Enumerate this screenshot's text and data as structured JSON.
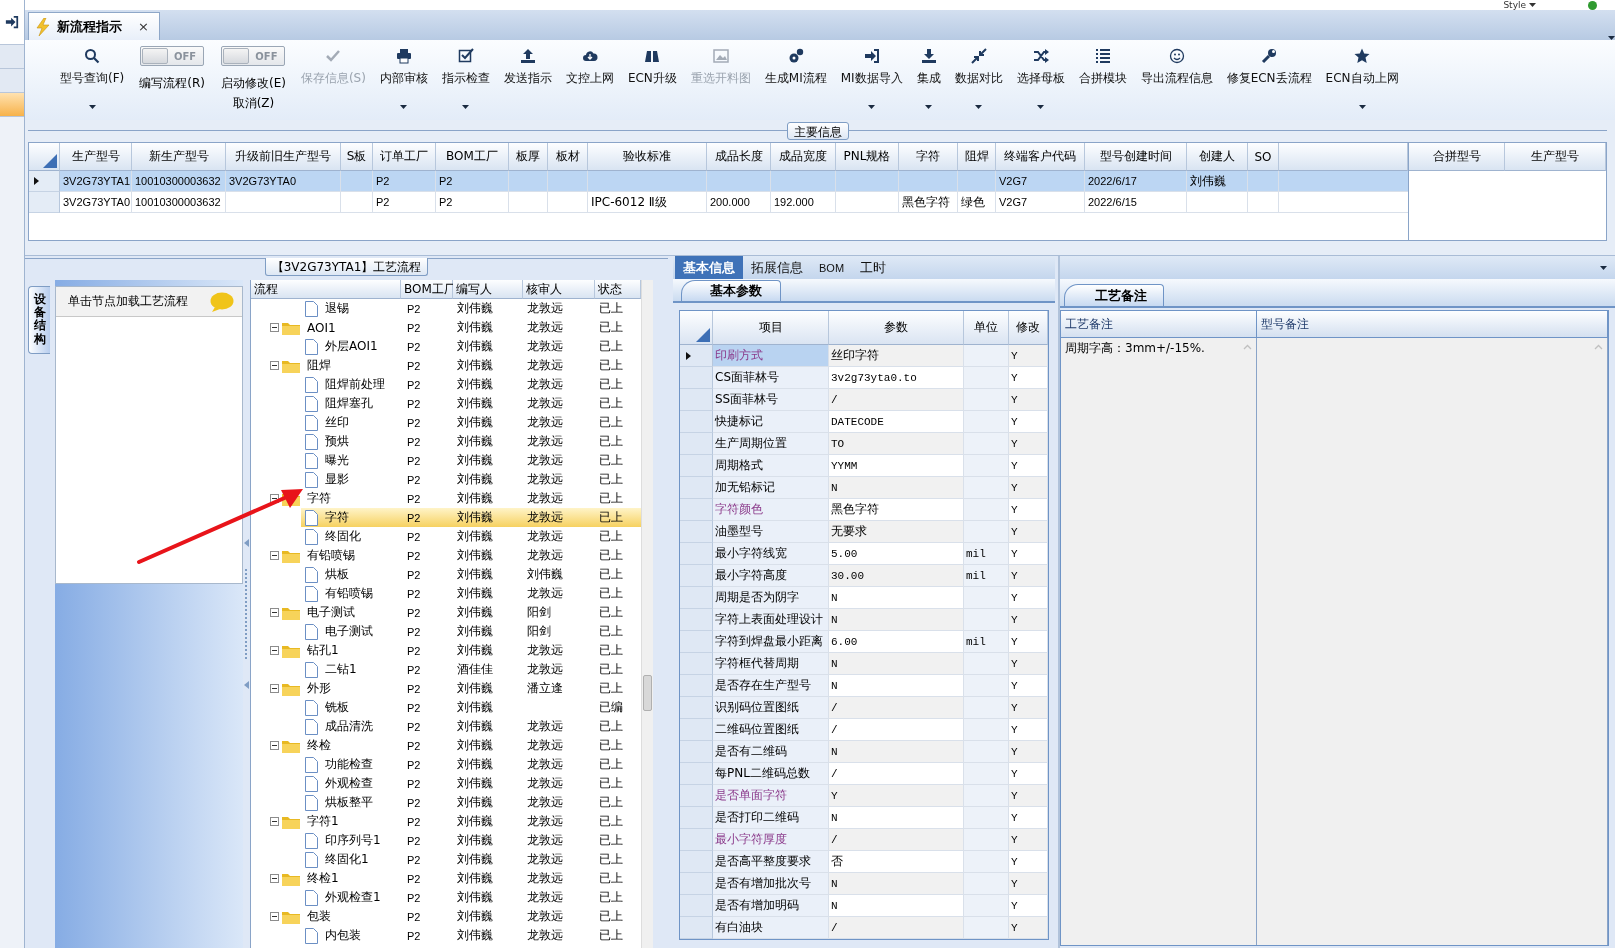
{
  "style_menu": {
    "label": "Style"
  },
  "left_nav": {
    "items": [
      {
        "selected": false
      },
      {
        "selected": false
      },
      {
        "selected": true
      }
    ]
  },
  "tabs": [
    {
      "label": "新流程指示",
      "selected": true,
      "close": "×"
    }
  ],
  "toolbar": {
    "items": [
      {
        "kind": "button",
        "label": "型号查询(F)",
        "dropdown": true,
        "disabled": false
      },
      {
        "kind": "toggle",
        "label": "编写流程(R)",
        "on": false,
        "switch_text": "OFF"
      },
      {
        "kind": "toggle",
        "label": "启动修改(E)",
        "sublabel": "取消(Z)",
        "on": false,
        "switch_text": "OFF"
      },
      {
        "kind": "button",
        "label": "保存信息(S)",
        "dropdown": false,
        "disabled": true
      },
      {
        "kind": "button",
        "label": "内部审核",
        "dropdown": true,
        "disabled": false
      },
      {
        "kind": "button",
        "label": "指示检查",
        "dropdown": true,
        "disabled": false
      },
      {
        "kind": "button",
        "label": "发送指示",
        "dropdown": false,
        "disabled": false
      },
      {
        "kind": "button",
        "label": "文控上网",
        "dropdown": false,
        "disabled": false
      },
      {
        "kind": "button",
        "label": "ECN升级",
        "dropdown": false,
        "disabled": false
      },
      {
        "kind": "button",
        "label": "重选开料图",
        "dropdown": false,
        "disabled": true
      },
      {
        "kind": "button",
        "label": "生成MI流程",
        "dropdown": false,
        "disabled": false
      },
      {
        "kind": "button",
        "label": "MI数据导入",
        "dropdown": true,
        "disabled": false
      },
      {
        "kind": "button",
        "label": "集成",
        "dropdown": true,
        "disabled": false
      },
      {
        "kind": "button",
        "label": "数据对比",
        "dropdown": true,
        "disabled": false
      },
      {
        "kind": "button",
        "label": "选择母板",
        "dropdown": true,
        "disabled": false
      },
      {
        "kind": "button",
        "label": "合拼模块",
        "dropdown": false,
        "disabled": false
      },
      {
        "kind": "button",
        "label": "导出流程信息",
        "dropdown": false,
        "disabled": false
      },
      {
        "kind": "button",
        "label": "修复ECN丢流程",
        "dropdown": false,
        "disabled": false
      },
      {
        "kind": "button",
        "label": "ECN自动上网",
        "dropdown": true,
        "disabled": false
      }
    ]
  },
  "main_info": {
    "title": "主要信息",
    "table": {
      "columns": [
        "生产型号",
        "新生产型号",
        "升级前旧生产型号",
        "S板",
        "订单工厂",
        "BOM工厂",
        "板厚",
        "板材",
        "验收标准",
        "成品长度",
        "成品宽度",
        "PNL规格",
        "字符",
        "阻焊",
        "终端客户代码",
        "型号创建时间",
        "创建人",
        "SO"
      ],
      "rows": [
        {
          "selected": true,
          "cells": [
            "3V2G73YTA1",
            "10010300003632",
            "3V2G73YTA0",
            null,
            "P2",
            "P2",
            null,
            null,
            null,
            null,
            null,
            null,
            null,
            null,
            "V2G7",
            "2022/6/17",
            "刘伟巍",
            null
          ]
        },
        {
          "selected": false,
          "cells": [
            "3V2G73YTA0",
            "10010300003632",
            null,
            null,
            "P2",
            "P2",
            null,
            null,
            "IPC-6012 Ⅱ级",
            "200.000",
            "192.000",
            null,
            "黑色字符",
            "绿色",
            "V2G7",
            "2022/6/15",
            null,
            null
          ]
        }
      ]
    },
    "merge_table": {
      "columns": [
        "合拼型号",
        "生产型号"
      ]
    }
  },
  "flow": {
    "title": "【3V2G73YTA1】工艺流程",
    "side_tab": "设备结构",
    "hint": "单击节点加载工艺流程",
    "tree": {
      "columns": [
        "流程",
        "BOM工厂",
        "编写人",
        "核审人",
        "状态"
      ],
      "nodes": [
        {
          "kind": "step",
          "name": "退锡",
          "bom": "P2",
          "writer": "刘伟巍",
          "reviewer": "龙敦远",
          "status": "已上",
          "selected": false
        },
        {
          "kind": "group",
          "name": "AOI1",
          "bom": "P2",
          "writer": "刘伟巍",
          "reviewer": "龙敦远",
          "status": "已上",
          "selected": false,
          "expanded": true,
          "children": [
            {
              "kind": "step",
              "name": "外层AOI1",
              "bom": "P2",
              "writer": "刘伟巍",
              "reviewer": "龙敦远",
              "status": "已上",
              "selected": false
            }
          ]
        },
        {
          "kind": "group",
          "name": "阻焊",
          "bom": "P2",
          "writer": "刘伟巍",
          "reviewer": "龙敦远",
          "status": "已上",
          "selected": false,
          "expanded": true,
          "children": [
            {
              "kind": "step",
              "name": "阻焊前处理",
              "bom": "P2",
              "writer": "刘伟巍",
              "reviewer": "龙敦远",
              "status": "已上",
              "selected": false
            },
            {
              "kind": "step",
              "name": "阻焊塞孔",
              "bom": "P2",
              "writer": "刘伟巍",
              "reviewer": "龙敦远",
              "status": "已上",
              "selected": false
            },
            {
              "kind": "step",
              "name": "丝印",
              "bom": "P2",
              "writer": "刘伟巍",
              "reviewer": "龙敦远",
              "status": "已上",
              "selected": false
            },
            {
              "kind": "step",
              "name": "预烘",
              "bom": "P2",
              "writer": "刘伟巍",
              "reviewer": "龙敦远",
              "status": "已上",
              "selected": false
            },
            {
              "kind": "step",
              "name": "曝光",
              "bom": "P2",
              "writer": "刘伟巍",
              "reviewer": "龙敦远",
              "status": "已上",
              "selected": false
            },
            {
              "kind": "step",
              "name": "显影",
              "bom": "P2",
              "writer": "刘伟巍",
              "reviewer": "龙敦远",
              "status": "已上",
              "selected": false
            }
          ]
        },
        {
          "kind": "group",
          "name": "字符",
          "bom": "P2",
          "writer": "刘伟巍",
          "reviewer": "龙敦远",
          "status": "已上",
          "selected": false,
          "expanded": true,
          "children": [
            {
              "kind": "step",
              "name": "字符",
              "bom": "P2",
              "writer": "刘伟巍",
              "reviewer": "龙敦远",
              "status": "已上",
              "selected": true
            },
            {
              "kind": "step",
              "name": "终固化",
              "bom": "P2",
              "writer": "刘伟巍",
              "reviewer": "龙敦远",
              "status": "已上",
              "selected": false
            }
          ]
        },
        {
          "kind": "group",
          "name": "有铅喷锡",
          "bom": "P2",
          "writer": "刘伟巍",
          "reviewer": "龙敦远",
          "status": "已上",
          "selected": false,
          "expanded": true,
          "children": [
            {
              "kind": "step",
              "name": "烘板",
              "bom": "P2",
              "writer": "刘伟巍",
              "reviewer": "刘伟巍",
              "status": "已上",
              "selected": false
            },
            {
              "kind": "step",
              "name": "有铅喷锡",
              "bom": "P2",
              "writer": "刘伟巍",
              "reviewer": "龙敦远",
              "status": "已上",
              "selected": false
            }
          ]
        },
        {
          "kind": "group",
          "name": "电子测试",
          "bom": "P2",
          "writer": "刘伟巍",
          "reviewer": "阳剑",
          "status": "已上",
          "selected": false,
          "expanded": true,
          "children": [
            {
              "kind": "step",
              "name": "电子测试",
              "bom": "P2",
              "writer": "刘伟巍",
              "reviewer": "阳剑",
              "status": "已上",
              "selected": false
            }
          ]
        },
        {
          "kind": "group",
          "name": "钻孔1",
          "bom": "P2",
          "writer": "刘伟巍",
          "reviewer": "龙敦远",
          "status": "已上",
          "selected": false,
          "expanded": true,
          "children": [
            {
              "kind": "step",
              "name": "二钻1",
              "bom": "P2",
              "writer": "酒佳佳",
              "reviewer": "龙敦远",
              "status": "已上",
              "selected": false
            }
          ]
        },
        {
          "kind": "group",
          "name": "外形",
          "bom": "P2",
          "writer": "刘伟巍",
          "reviewer": "潘立逢",
          "status": "已上",
          "selected": false,
          "expanded": true,
          "children": [
            {
              "kind": "step",
              "name": "铣板",
              "bom": "P2",
              "writer": "刘伟巍",
              "status": "已编",
              "selected": false
            },
            {
              "kind": "step",
              "name": "成品清洗",
              "bom": "P2",
              "writer": "刘伟巍",
              "reviewer": "龙敦远",
              "status": "已上",
              "selected": false
            }
          ]
        },
        {
          "kind": "group",
          "name": "终检",
          "bom": "P2",
          "writer": "刘伟巍",
          "reviewer": "龙敦远",
          "status": "已上",
          "selected": false,
          "expanded": true,
          "children": [
            {
              "kind": "step",
              "name": "功能检查",
              "bom": "P2",
              "writer": "刘伟巍",
              "reviewer": "龙敦远",
              "status": "已上",
              "selected": false
            },
            {
              "kind": "step",
              "name": "外观检查",
              "bom": "P2",
              "writer": "刘伟巍",
              "reviewer": "龙敦远",
              "status": "已上",
              "selected": false
            },
            {
              "kind": "step",
              "name": "烘板整平",
              "bom": "P2",
              "writer": "刘伟巍",
              "reviewer": "龙敦远",
              "status": "已上",
              "selected": false
            }
          ]
        },
        {
          "kind": "group",
          "name": "字符1",
          "bom": "P2",
          "writer": "刘伟巍",
          "reviewer": "龙敦远",
          "status": "已上",
          "selected": false,
          "expanded": true,
          "children": [
            {
              "kind": "step",
              "name": "印序列号1",
              "bom": "P2",
              "writer": "刘伟巍",
              "reviewer": "龙敦远",
              "status": "已上",
              "selected": false
            },
            {
              "kind": "step",
              "name": "终固化1",
              "bom": "P2",
              "writer": "刘伟巍",
              "reviewer": "龙敦远",
              "status": "已上",
              "selected": false
            }
          ]
        },
        {
          "kind": "group",
          "name": "终检1",
          "bom": "P2",
          "writer": "刘伟巍",
          "reviewer": "龙敦远",
          "status": "已上",
          "selected": false,
          "expanded": true,
          "children": [
            {
              "kind": "step",
              "name": "外观检查1",
              "bom": "P2",
              "writer": "刘伟巍",
              "reviewer": "龙敦远",
              "status": "已上",
              "selected": false
            }
          ]
        },
        {
          "kind": "group",
          "name": "包装",
          "bom": "P2",
          "writer": "刘伟巍",
          "reviewer": "龙敦远",
          "status": "已上",
          "selected": false,
          "expanded": true,
          "children": [
            {
              "kind": "step",
              "name": "内包装",
              "bom": "P2",
              "writer": "刘伟巍",
              "reviewer": "龙敦远",
              "status": "已上",
              "selected": false
            }
          ]
        }
      ]
    }
  },
  "params": {
    "tabs": [
      {
        "label": "基本信息",
        "selected": true
      },
      {
        "label": "拓展信息",
        "selected": false
      },
      {
        "label": "BOM",
        "selected": false
      },
      {
        "label": "工时",
        "selected": false
      }
    ],
    "subtab": "基本参数",
    "table": {
      "columns": [
        "项目",
        "参数",
        "单位",
        "修改"
      ],
      "rows": [
        {
          "item": "印刷方式",
          "value": "丝印字符",
          "modified": "Y",
          "highlighted": true,
          "selected": true
        },
        {
          "item": "CS面菲林号",
          "value": "3v2g73yta0.to",
          "modified": "Y",
          "highlighted": false,
          "selected": false
        },
        {
          "item": "SS面菲林号",
          "value": "/",
          "modified": "Y",
          "highlighted": false,
          "selected": false
        },
        {
          "item": "快捷标记",
          "value": "DATECODE",
          "modified": "Y",
          "highlighted": false,
          "selected": false
        },
        {
          "item": "生产周期位置",
          "value": "TO",
          "modified": "Y",
          "highlighted": false,
          "selected": false
        },
        {
          "item": "周期格式",
          "value": "YYMM",
          "modified": "Y",
          "highlighted": false,
          "selected": false
        },
        {
          "item": "加无铅标记",
          "value": "N",
          "modified": "Y",
          "highlighted": false,
          "selected": false
        },
        {
          "item": "字符颜色",
          "value": "黑色字符",
          "modified": "Y",
          "highlighted": true,
          "selected": false
        },
        {
          "item": "油墨型号",
          "value": "无要求",
          "modified": "Y",
          "highlighted": false,
          "selected": false
        },
        {
          "item": "最小字符线宽",
          "value": "5.00",
          "unit": "mil",
          "modified": "Y",
          "highlighted": false,
          "selected": false
        },
        {
          "item": "最小字符高度",
          "value": "30.00",
          "unit": "mil",
          "modified": "Y",
          "highlighted": false,
          "selected": false
        },
        {
          "item": "周期是否为阴字",
          "value": "N",
          "modified": "Y",
          "highlighted": false,
          "selected": false
        },
        {
          "item": "字符上表面处理设计",
          "value": "N",
          "modified": "Y",
          "highlighted": false,
          "selected": false
        },
        {
          "item": "字符到焊盘最小距离",
          "value": "6.00",
          "unit": "mil",
          "modified": "Y",
          "highlighted": false,
          "selected": false
        },
        {
          "item": "字符框代替周期",
          "value": "N",
          "modified": "Y",
          "highlighted": false,
          "selected": false
        },
        {
          "item": "是否存在生产型号",
          "value": "N",
          "modified": "Y",
          "highlighted": false,
          "selected": false
        },
        {
          "item": "识别码位置图纸",
          "value": "/",
          "modified": "Y",
          "highlighted": false,
          "selected": false
        },
        {
          "item": "二维码位置图纸",
          "value": "/",
          "modified": "Y",
          "highlighted": false,
          "selected": false
        },
        {
          "item": "是否有二维码",
          "value": "N",
          "modified": "Y",
          "highlighted": false,
          "selected": false
        },
        {
          "item": "每PNL二维码总数",
          "value": "/",
          "modified": "Y",
          "highlighted": false,
          "selected": false
        },
        {
          "item": "是否单面字符",
          "value": "Y",
          "modified": "Y",
          "highlighted": true,
          "selected": false
        },
        {
          "item": "是否打印二维码",
          "value": "N",
          "modified": "Y",
          "highlighted": false,
          "selected": false
        },
        {
          "item": "最小字符厚度",
          "value": "/",
          "modified": "Y",
          "highlighted": true,
          "selected": false
        },
        {
          "item": "是否高平整度要求",
          "value": "否",
          "modified": "Y",
          "highlighted": false,
          "selected": false
        },
        {
          "item": "是否有增加批次号",
          "value": "N",
          "modified": "Y",
          "highlighted": false,
          "selected": false
        },
        {
          "item": "是否有增加明码",
          "value": "N",
          "modified": "Y",
          "highlighted": false,
          "selected": false
        },
        {
          "item": "有白油块",
          "value": "/",
          "modified": "Y",
          "highlighted": false,
          "selected": false
        }
      ]
    }
  },
  "notes": {
    "tab": "工艺备注",
    "columns": [
      "工艺备注",
      "型号备注"
    ],
    "process_note": "周期字高：3mm+/-15%."
  }
}
